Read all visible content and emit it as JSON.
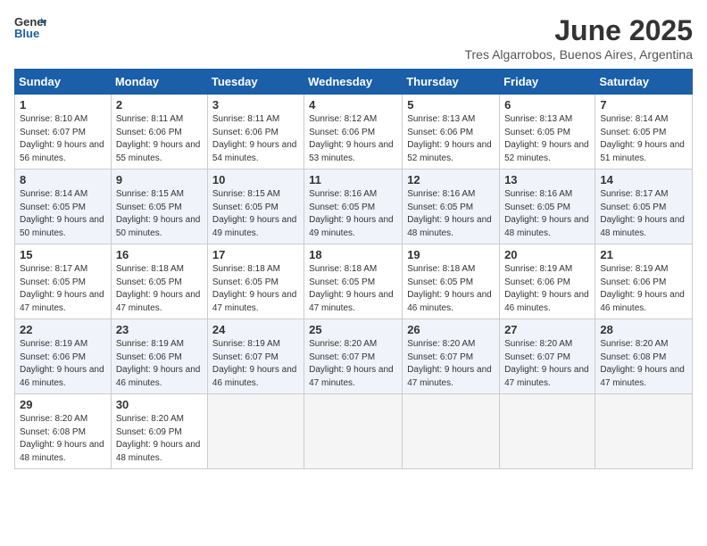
{
  "logo": {
    "line1": "General",
    "line2": "Blue"
  },
  "title": "June 2025",
  "subtitle": "Tres Algarrobos, Buenos Aires, Argentina",
  "days_of_week": [
    "Sunday",
    "Monday",
    "Tuesday",
    "Wednesday",
    "Thursday",
    "Friday",
    "Saturday"
  ],
  "weeks": [
    [
      {
        "num": "1",
        "rise": "8:10 AM",
        "set": "6:07 PM",
        "daylight": "9 hours and 56 minutes."
      },
      {
        "num": "2",
        "rise": "8:11 AM",
        "set": "6:06 PM",
        "daylight": "9 hours and 55 minutes."
      },
      {
        "num": "3",
        "rise": "8:11 AM",
        "set": "6:06 PM",
        "daylight": "9 hours and 54 minutes."
      },
      {
        "num": "4",
        "rise": "8:12 AM",
        "set": "6:06 PM",
        "daylight": "9 hours and 53 minutes."
      },
      {
        "num": "5",
        "rise": "8:13 AM",
        "set": "6:06 PM",
        "daylight": "9 hours and 52 minutes."
      },
      {
        "num": "6",
        "rise": "8:13 AM",
        "set": "6:05 PM",
        "daylight": "9 hours and 52 minutes."
      },
      {
        "num": "7",
        "rise": "8:14 AM",
        "set": "6:05 PM",
        "daylight": "9 hours and 51 minutes."
      }
    ],
    [
      {
        "num": "8",
        "rise": "8:14 AM",
        "set": "6:05 PM",
        "daylight": "9 hours and 50 minutes."
      },
      {
        "num": "9",
        "rise": "8:15 AM",
        "set": "6:05 PM",
        "daylight": "9 hours and 50 minutes."
      },
      {
        "num": "10",
        "rise": "8:15 AM",
        "set": "6:05 PM",
        "daylight": "9 hours and 49 minutes."
      },
      {
        "num": "11",
        "rise": "8:16 AM",
        "set": "6:05 PM",
        "daylight": "9 hours and 49 minutes."
      },
      {
        "num": "12",
        "rise": "8:16 AM",
        "set": "6:05 PM",
        "daylight": "9 hours and 48 minutes."
      },
      {
        "num": "13",
        "rise": "8:16 AM",
        "set": "6:05 PM",
        "daylight": "9 hours and 48 minutes."
      },
      {
        "num": "14",
        "rise": "8:17 AM",
        "set": "6:05 PM",
        "daylight": "9 hours and 48 minutes."
      }
    ],
    [
      {
        "num": "15",
        "rise": "8:17 AM",
        "set": "6:05 PM",
        "daylight": "9 hours and 47 minutes."
      },
      {
        "num": "16",
        "rise": "8:18 AM",
        "set": "6:05 PM",
        "daylight": "9 hours and 47 minutes."
      },
      {
        "num": "17",
        "rise": "8:18 AM",
        "set": "6:05 PM",
        "daylight": "9 hours and 47 minutes."
      },
      {
        "num": "18",
        "rise": "8:18 AM",
        "set": "6:05 PM",
        "daylight": "9 hours and 47 minutes."
      },
      {
        "num": "19",
        "rise": "8:18 AM",
        "set": "6:05 PM",
        "daylight": "9 hours and 46 minutes."
      },
      {
        "num": "20",
        "rise": "8:19 AM",
        "set": "6:06 PM",
        "daylight": "9 hours and 46 minutes."
      },
      {
        "num": "21",
        "rise": "8:19 AM",
        "set": "6:06 PM",
        "daylight": "9 hours and 46 minutes."
      }
    ],
    [
      {
        "num": "22",
        "rise": "8:19 AM",
        "set": "6:06 PM",
        "daylight": "9 hours and 46 minutes."
      },
      {
        "num": "23",
        "rise": "8:19 AM",
        "set": "6:06 PM",
        "daylight": "9 hours and 46 minutes."
      },
      {
        "num": "24",
        "rise": "8:19 AM",
        "set": "6:07 PM",
        "daylight": "9 hours and 46 minutes."
      },
      {
        "num": "25",
        "rise": "8:20 AM",
        "set": "6:07 PM",
        "daylight": "9 hours and 47 minutes."
      },
      {
        "num": "26",
        "rise": "8:20 AM",
        "set": "6:07 PM",
        "daylight": "9 hours and 47 minutes."
      },
      {
        "num": "27",
        "rise": "8:20 AM",
        "set": "6:07 PM",
        "daylight": "9 hours and 47 minutes."
      },
      {
        "num": "28",
        "rise": "8:20 AM",
        "set": "6:08 PM",
        "daylight": "9 hours and 47 minutes."
      }
    ],
    [
      {
        "num": "29",
        "rise": "8:20 AM",
        "set": "6:08 PM",
        "daylight": "9 hours and 48 minutes."
      },
      {
        "num": "30",
        "rise": "8:20 AM",
        "set": "6:09 PM",
        "daylight": "9 hours and 48 minutes."
      },
      null,
      null,
      null,
      null,
      null
    ]
  ]
}
